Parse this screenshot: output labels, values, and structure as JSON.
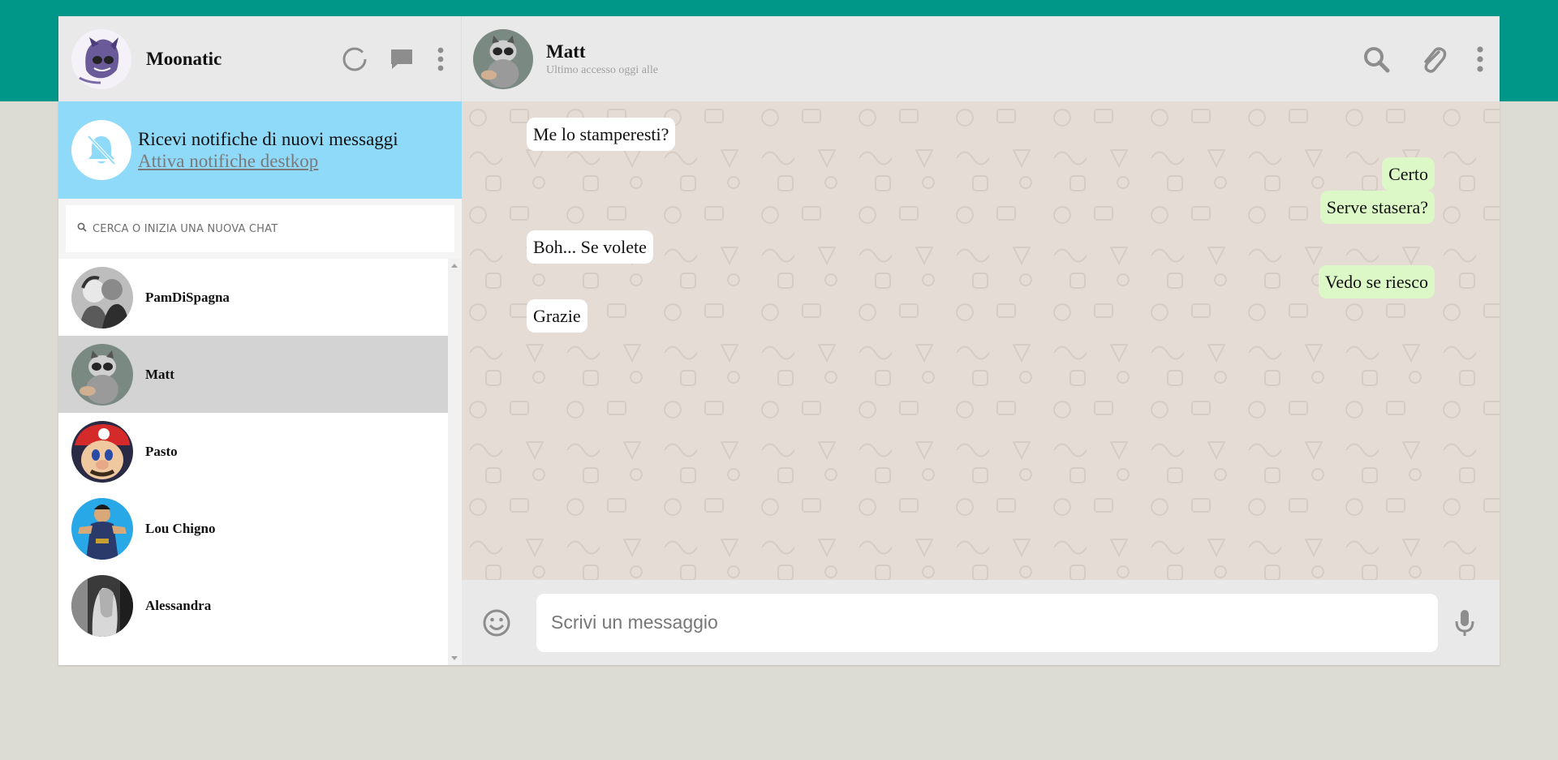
{
  "user": {
    "name": "Moonatic",
    "avatar": "user-avatar"
  },
  "header_icons": [
    "status-icon",
    "new-chat-icon",
    "menu-icon"
  ],
  "notification": {
    "title": "Ricevi notifiche di nuovi messaggi",
    "link": "Attiva notifiche destkop",
    "icon": "bell-off-icon"
  },
  "search": {
    "placeholder": "CERCA O INIZIA UNA NUOVA CHAT",
    "icon": "search-icon"
  },
  "chats": [
    {
      "name": "PamDiSpagna",
      "active": false
    },
    {
      "name": "Matt",
      "active": true
    },
    {
      "name": "Pasto",
      "active": false
    },
    {
      "name": "Lou Chigno",
      "active": false
    },
    {
      "name": "Alessandra",
      "active": false
    }
  ],
  "conversation": {
    "contact_name": "Matt",
    "status": "Ultimo accesso oggi alle",
    "icons": [
      "search-icon",
      "attach-icon",
      "menu-icon"
    ],
    "messages": [
      {
        "direction": "in",
        "text": "Me lo stamperesti?"
      },
      {
        "direction": "out",
        "text": "Certo"
      },
      {
        "direction": "out",
        "text": "Serve stasera?"
      },
      {
        "direction": "in",
        "text": "Boh... Se volete"
      },
      {
        "direction": "out",
        "text": "Vedo se riesco"
      },
      {
        "direction": "in",
        "text": "Grazie"
      }
    ]
  },
  "composer": {
    "placeholder": "Scrivi un messaggio",
    "emoji_icon": "emoji-icon",
    "mic_icon": "mic-icon"
  },
  "colors": {
    "topband": "#009688",
    "notification": "#8fd9f9",
    "outgoing_bubble": "#dcf8c6",
    "incoming_bubble": "#ffffff",
    "chat_bg": "#e5ddd5",
    "active_chat": "#d3d3d3"
  }
}
